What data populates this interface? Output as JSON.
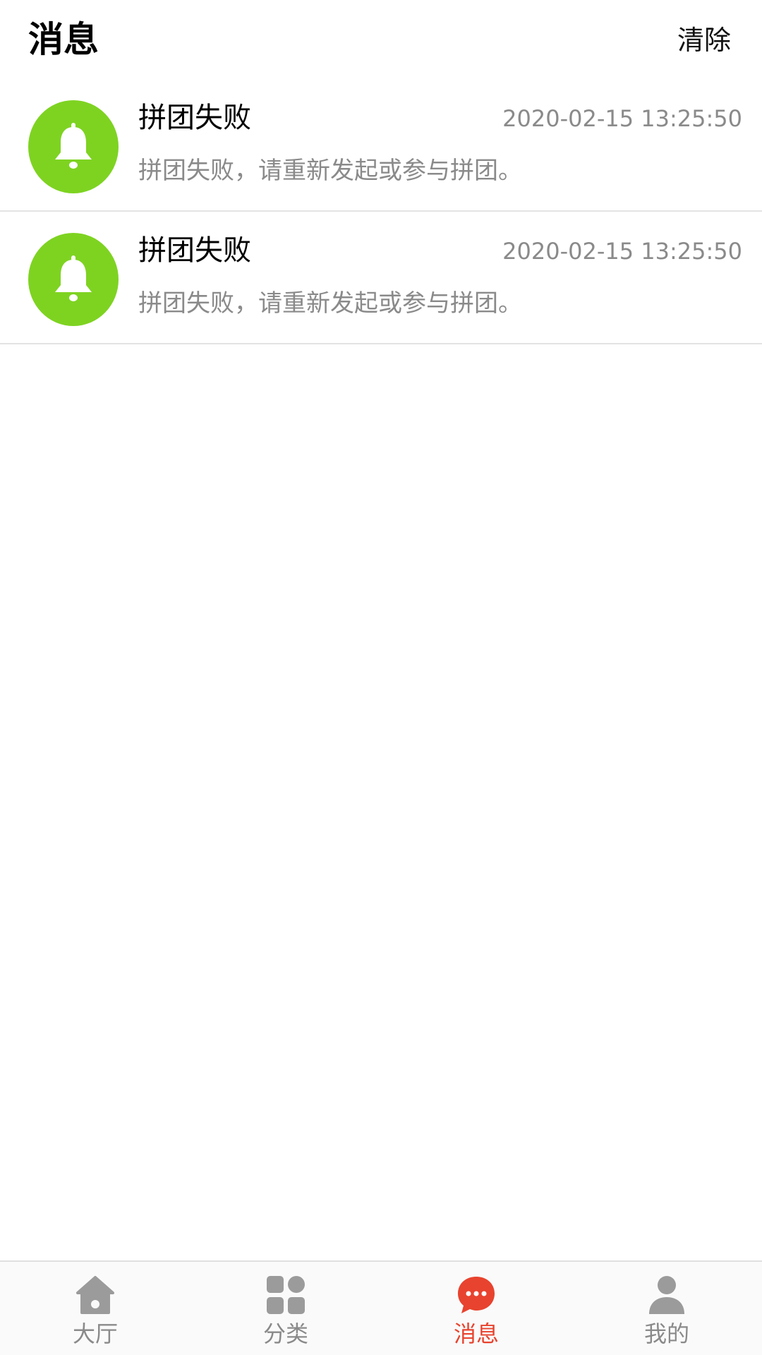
{
  "header": {
    "title": "消息",
    "clear_label": "清除"
  },
  "messages": [
    {
      "icon": "bell-icon",
      "title": "拼团失败",
      "time": "2020-02-15 13:25:50",
      "body": "拼团失败，请重新发起或参与拼团。"
    },
    {
      "icon": "bell-icon",
      "title": "拼团失败",
      "time": "2020-02-15 13:25:50",
      "body": "拼团失败，请重新发起或参与拼团。"
    }
  ],
  "tabbar": {
    "active_index": 2,
    "items": [
      {
        "label": "大厅",
        "icon": "home-icon"
      },
      {
        "label": "分类",
        "icon": "grid-icon"
      },
      {
        "label": "消息",
        "icon": "chat-bubble-icon"
      },
      {
        "label": "我的",
        "icon": "person-icon"
      }
    ]
  },
  "colors": {
    "accent": "#e8432e",
    "avatar_bg": "#7ed321",
    "tab_inactive": "#9b9b9b",
    "secondary_text": "#8a8a8a"
  }
}
